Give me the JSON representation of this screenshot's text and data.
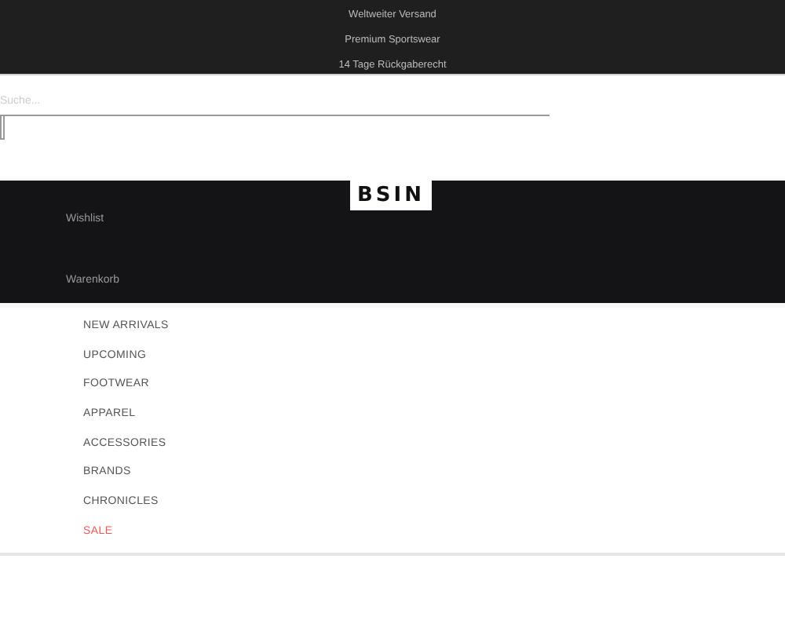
{
  "top_bar": {
    "messages": [
      "Weltweiter Versand",
      "Premium Sportswear",
      "14 Tage Rückgaberecht"
    ]
  },
  "search": {
    "placeholder": "Suche..."
  },
  "header": {
    "logo": "BSIN",
    "links": [
      "Wishlist",
      "Warenkorb"
    ]
  },
  "nav": [
    {
      "label": "NEW ARRIVALS",
      "kind": "regular"
    },
    {
      "label": "UPCOMING",
      "kind": "regular"
    },
    {
      "label": "FOOTWEAR",
      "kind": "regular"
    },
    {
      "label": "APPAREL",
      "kind": "regular"
    },
    {
      "label": "ACCESSORIES",
      "kind": "regular"
    },
    {
      "label": "BRANDS",
      "kind": "regular"
    },
    {
      "label": "CHRONICLES",
      "kind": "regular"
    },
    {
      "label": "SALE",
      "kind": "sale"
    }
  ]
}
